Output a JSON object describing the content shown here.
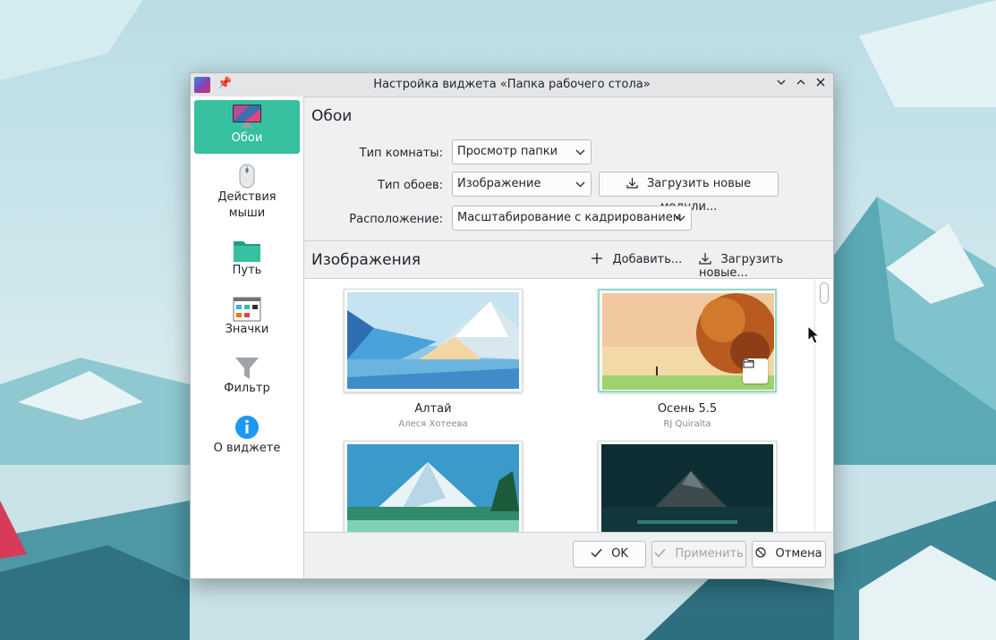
{
  "window": {
    "title": "Настройка виджета «Папка рабочего стола»",
    "controls": {
      "minimize": "﹀",
      "maximize": "︿",
      "close": "✕"
    }
  },
  "sidebar": {
    "items": [
      {
        "label": "Обои",
        "icon": "monitor-icon",
        "active": true
      },
      {
        "label": "Действия мыши",
        "icon": "mouse-icon",
        "active": false
      },
      {
        "label": "Путь",
        "icon": "folder-icon",
        "active": false
      },
      {
        "label": "Значки",
        "icon": "icons-view-icon",
        "active": false
      },
      {
        "label": "Фильтр",
        "icon": "filter-icon",
        "active": false
      },
      {
        "label": "О виджете",
        "icon": "info-icon",
        "active": false
      }
    ]
  },
  "wallpaper": {
    "title": "Обои",
    "layout_label": "Тип комнаты:",
    "layout_value": "Просмотр папки",
    "type_label": "Тип обоев:",
    "type_value": "Изображение",
    "get_plugins_label": "Загрузить новые модули...",
    "positioning_label": "Расположение:",
    "positioning_value": "Масштабирование с кадрированием"
  },
  "images": {
    "title": "Изображения",
    "add_label": "Добавить...",
    "get_new_label": "Загрузить новые...",
    "items": [
      {
        "title": "Алтай",
        "author": "Алеся Хотеева",
        "selected": false
      },
      {
        "title": "Осень 5.5",
        "author": "RJ Quiralta",
        "selected": true
      },
      {
        "title": "",
        "author": "",
        "selected": false
      },
      {
        "title": "",
        "author": "",
        "selected": false
      }
    ]
  },
  "footer": {
    "ok": "OK",
    "apply": "Применить",
    "cancel": "Отмена"
  },
  "colors": {
    "accent": "#36c0a0",
    "window_bg": "#eff0f1"
  }
}
